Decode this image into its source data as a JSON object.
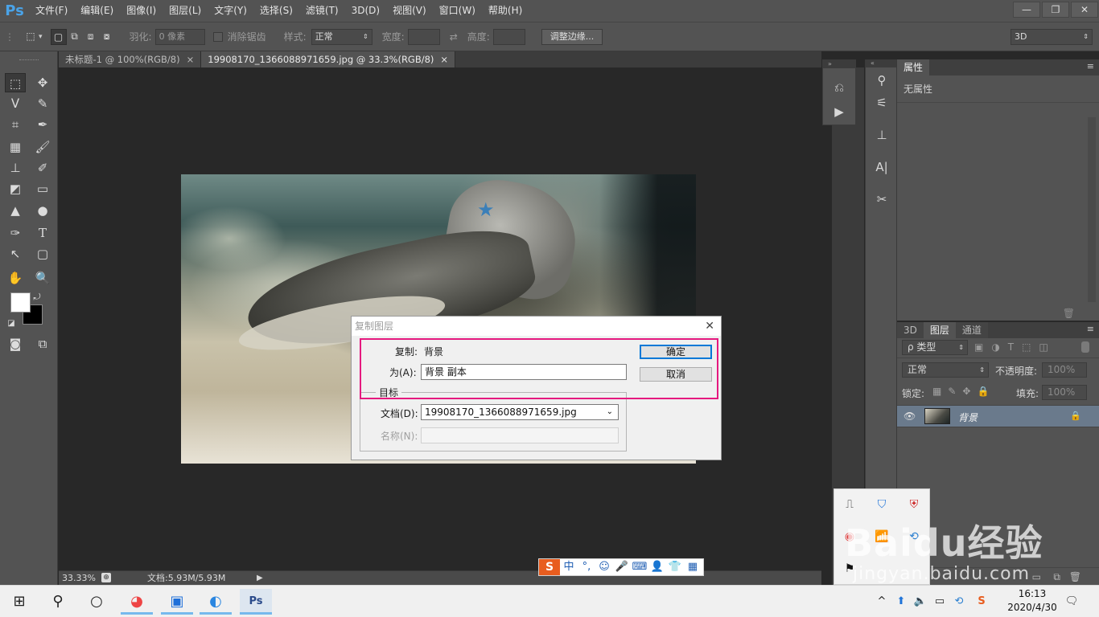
{
  "app": {
    "logo": "Ps"
  },
  "menubar": {
    "items": [
      "文件(F)",
      "编辑(E)",
      "图像(I)",
      "图层(L)",
      "文字(Y)",
      "选择(S)",
      "滤镜(T)",
      "3D(D)",
      "视图(V)",
      "窗口(W)",
      "帮助(H)"
    ]
  },
  "window_controls": {
    "minimize": "—",
    "restore": "❐",
    "close": "✕"
  },
  "options": {
    "feather_label": "羽化:",
    "feather_value": "0 像素",
    "antialias_label": "消除锯齿",
    "style_label": "样式:",
    "style_value": "正常",
    "width_label": "宽度:",
    "height_label": "高度:",
    "refine_edge": "调整边缘...",
    "workspace": "3D"
  },
  "doc_tabs": [
    {
      "label": "未标题-1 @ 100%(RGB/8)",
      "close": "×"
    },
    {
      "label": "19908170_1366088971659.jpg @ 33.3%(RGB/8)",
      "close": "×"
    }
  ],
  "statusbar": {
    "zoom": "33.33%",
    "doc_info": "文档:5.93M/5.93M"
  },
  "dialog": {
    "title": "复制图层",
    "duplicate_label": "复制:",
    "duplicate_value": "背景",
    "as_label": "为(A):",
    "as_value": "背景 副本",
    "destination_group": "目标",
    "document_label": "文档(D):",
    "document_value": "19908170_1366088971659.jpg",
    "name_label": "名称(N):",
    "ok": "确定",
    "cancel": "取消"
  },
  "properties_panel": {
    "tab": "属性",
    "empty_text": "无属性"
  },
  "layers_panel": {
    "tabs": [
      "3D",
      "图层",
      "通道"
    ],
    "active_tab": "图层",
    "filter_label": "ρ 类型",
    "blend_mode": "正常",
    "opacity_label": "不透明度:",
    "opacity_value": "100%",
    "lock_label": "锁定:",
    "fill_label": "填充:",
    "fill_value": "100%",
    "layers": [
      {
        "name": "背景",
        "locked": true,
        "visible": true
      }
    ]
  },
  "ime": {
    "mode": "中"
  },
  "watermark": {
    "line1": "Baidu经验",
    "line2": "jingyan.baidu.com"
  },
  "taskbar": {
    "time": "16:13",
    "date": "2020/4/30"
  },
  "colors": {
    "accent": "#e5197f",
    "ps_blue": "#4aa3e8",
    "panel": "#535353",
    "canvas": "#282828"
  }
}
